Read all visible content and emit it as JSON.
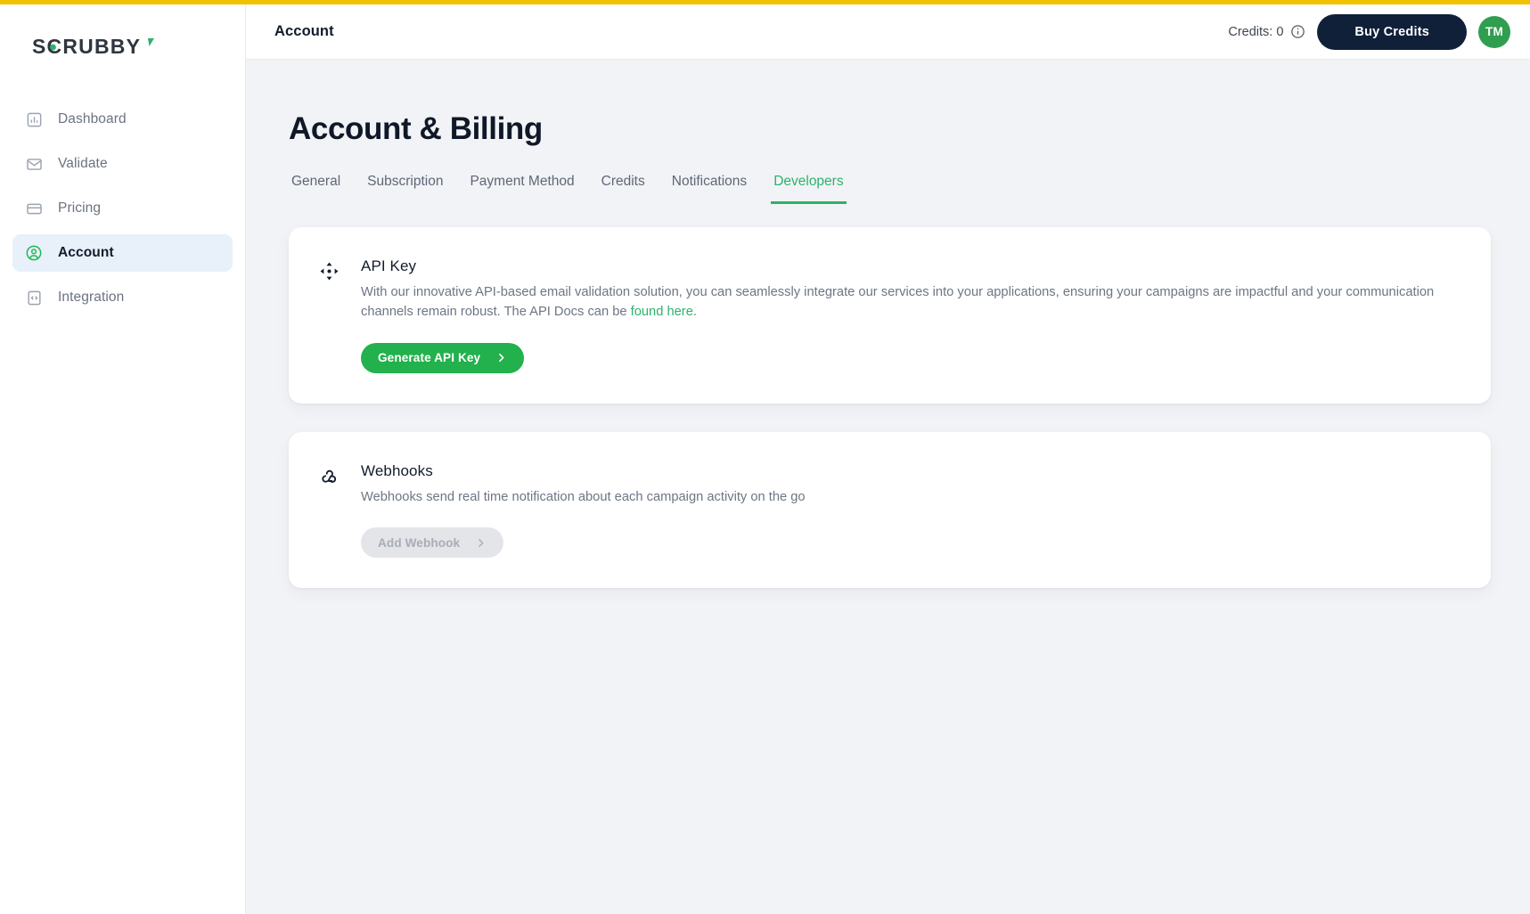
{
  "brand": {
    "logo_text": "SCRUBBY",
    "accent_green": "#2db26b",
    "top_stripe_color": "#f2c200"
  },
  "sidebar": {
    "items": [
      {
        "label": "Dashboard",
        "icon": "bar-chart-icon",
        "active": false
      },
      {
        "label": "Validate",
        "icon": "envelope-icon",
        "active": false
      },
      {
        "label": "Pricing",
        "icon": "credit-card-icon",
        "active": false
      },
      {
        "label": "Account",
        "icon": "user-circle-icon",
        "active": true
      },
      {
        "label": "Integration",
        "icon": "code-brackets-icon",
        "active": false
      }
    ]
  },
  "topbar": {
    "title": "Account",
    "credits_label": "Credits: 0",
    "info_icon": "info-icon",
    "buy_credits_label": "Buy Credits",
    "avatar_initials": "TM",
    "avatar_color": "#2f9e4f",
    "buy_button_color": "#102039"
  },
  "page": {
    "title": "Account & Billing",
    "tabs": [
      {
        "label": "General",
        "active": false
      },
      {
        "label": "Subscription",
        "active": false
      },
      {
        "label": "Payment Method",
        "active": false
      },
      {
        "label": "Credits",
        "active": false
      },
      {
        "label": "Notifications",
        "active": false
      },
      {
        "label": "Developers",
        "active": true
      }
    ]
  },
  "cards": {
    "api_key": {
      "icon": "api-move-icon",
      "title": "API Key",
      "description_before": "With our innovative API-based email validation solution, you can seamlessly integrate our services into your applications, ensuring your campaigns are impactful and your communication channels remain robust. The API Docs can be ",
      "link_text": "found here",
      "description_after": ".",
      "button_label": "Generate API Key",
      "button_icon": "chevron-right-icon",
      "button_color": "#22b14c",
      "button_disabled": false
    },
    "webhooks": {
      "icon": "webhook-icon",
      "title": "Webhooks",
      "description": "Webhooks send real time notification about each campaign activity on the go",
      "button_label": "Add Webhook",
      "button_icon": "chevron-right-icon",
      "button_disabled": true
    }
  }
}
